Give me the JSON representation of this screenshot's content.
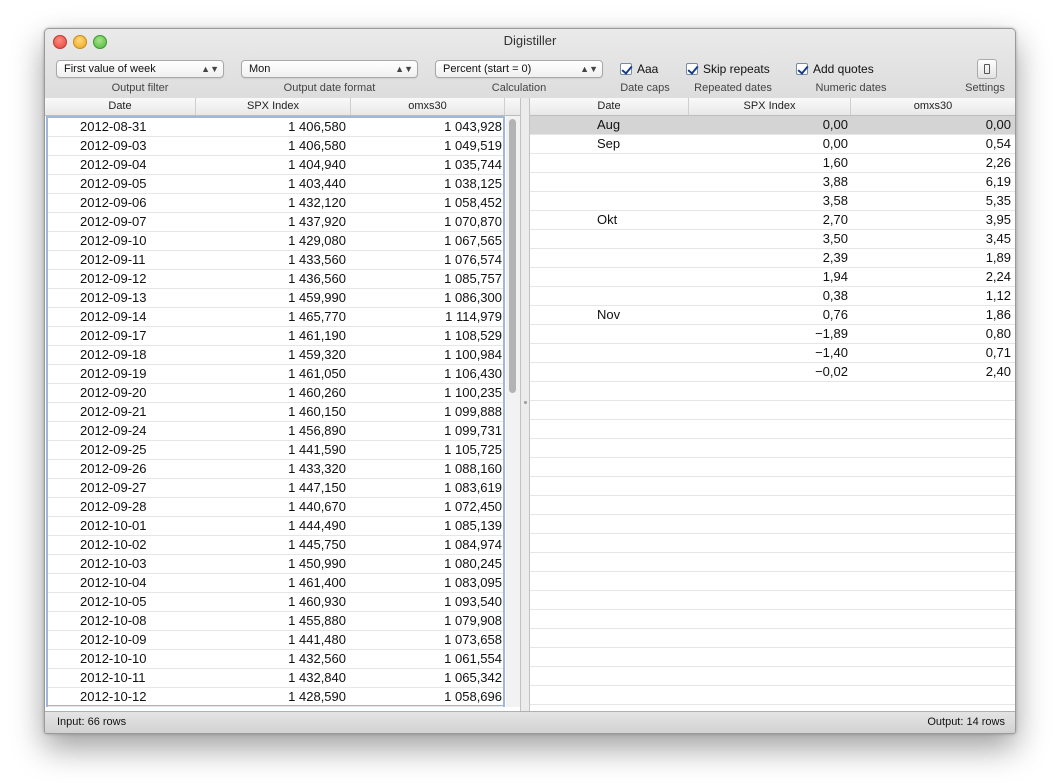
{
  "window": {
    "title": "Digistiller"
  },
  "toolbar": {
    "output_filter": {
      "value": "First value of week",
      "label": "Output filter"
    },
    "date_format": {
      "value": "Mon",
      "label": "Output date format"
    },
    "calculation": {
      "value": "Percent (start = 0)",
      "label": "Calculation"
    },
    "date_caps": {
      "text": "Aaa",
      "label": "Date caps",
      "checked": true
    },
    "repeated_dates": {
      "text": "Skip repeats",
      "label": "Repeated dates",
      "checked": true
    },
    "numeric_dates": {
      "text": "Add quotes",
      "label": "Numeric dates",
      "checked": true
    },
    "settings": {
      "label": "Settings",
      "icon": "settings-icon"
    }
  },
  "input_table": {
    "columns": [
      "Date",
      "SPX Index",
      "omxs30"
    ],
    "rows": [
      [
        "2012-08-31",
        "1 406,580",
        "1 043,928"
      ],
      [
        "2012-09-03",
        "1 406,580",
        "1 049,519"
      ],
      [
        "2012-09-04",
        "1 404,940",
        "1 035,744"
      ],
      [
        "2012-09-05",
        "1 403,440",
        "1 038,125"
      ],
      [
        "2012-09-06",
        "1 432,120",
        "1 058,452"
      ],
      [
        "2012-09-07",
        "1 437,920",
        "1 070,870"
      ],
      [
        "2012-09-10",
        "1 429,080",
        "1 067,565"
      ],
      [
        "2012-09-11",
        "1 433,560",
        "1 076,574"
      ],
      [
        "2012-09-12",
        "1 436,560",
        "1 085,757"
      ],
      [
        "2012-09-13",
        "1 459,990",
        "1 086,300"
      ],
      [
        "2012-09-14",
        "1 465,770",
        "1 114,979"
      ],
      [
        "2012-09-17",
        "1 461,190",
        "1 108,529"
      ],
      [
        "2012-09-18",
        "1 459,320",
        "1 100,984"
      ],
      [
        "2012-09-19",
        "1 461,050",
        "1 106,430"
      ],
      [
        "2012-09-20",
        "1 460,260",
        "1 100,235"
      ],
      [
        "2012-09-21",
        "1 460,150",
        "1 099,888"
      ],
      [
        "2012-09-24",
        "1 456,890",
        "1 099,731"
      ],
      [
        "2012-09-25",
        "1 441,590",
        "1 105,725"
      ],
      [
        "2012-09-26",
        "1 433,320",
        "1 088,160"
      ],
      [
        "2012-09-27",
        "1 447,150",
        "1 083,619"
      ],
      [
        "2012-09-28",
        "1 440,670",
        "1 072,450"
      ],
      [
        "2012-10-01",
        "1 444,490",
        "1 085,139"
      ],
      [
        "2012-10-02",
        "1 445,750",
        "1 084,974"
      ],
      [
        "2012-10-03",
        "1 450,990",
        "1 080,245"
      ],
      [
        "2012-10-04",
        "1 461,400",
        "1 083,095"
      ],
      [
        "2012-10-05",
        "1 460,930",
        "1 093,540"
      ],
      [
        "2012-10-08",
        "1 455,880",
        "1 079,908"
      ],
      [
        "2012-10-09",
        "1 441,480",
        "1 073,658"
      ],
      [
        "2012-10-10",
        "1 432,560",
        "1 061,554"
      ],
      [
        "2012-10-11",
        "1 432,840",
        "1 065,342"
      ],
      [
        "2012-10-12",
        "1 428,590",
        "1 058,696"
      ]
    ]
  },
  "output_table": {
    "columns": [
      "Date",
      "SPX Index",
      "omxs30"
    ],
    "rows": [
      [
        "Aug",
        "0,00",
        "0,00"
      ],
      [
        "Sep",
        "0,00",
        "0,54"
      ],
      [
        "",
        "1,60",
        "2,26"
      ],
      [
        "",
        "3,88",
        "6,19"
      ],
      [
        "",
        "3,58",
        "5,35"
      ],
      [
        "Okt",
        "2,70",
        "3,95"
      ],
      [
        "",
        "3,50",
        "3,45"
      ],
      [
        "",
        "2,39",
        "1,89"
      ],
      [
        "",
        "1,94",
        "2,24"
      ],
      [
        "",
        "0,38",
        "1,12"
      ],
      [
        "Nov",
        "0,76",
        "1,86"
      ],
      [
        "",
        "−1,89",
        "0,80"
      ],
      [
        "",
        "−1,40",
        "0,71"
      ],
      [
        "",
        "−0,02",
        "2,40"
      ]
    ],
    "empty_rows": 17,
    "selected_row": 0
  },
  "status": {
    "input": "Input: 66 rows",
    "output": "Output: 14 rows"
  }
}
